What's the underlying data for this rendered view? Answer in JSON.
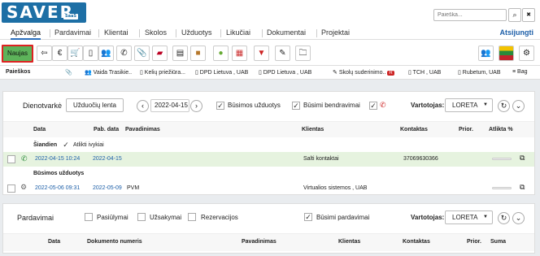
{
  "app": {
    "logo": "SAVER",
    "logo_sub": "SaaS",
    "search_placeholder": "Paieška..."
  },
  "nav": {
    "items": [
      "Apžvalga",
      "Pardavimai",
      "Klientai",
      "Skolos",
      "Užduotys",
      "Likučiai",
      "Dokumentai",
      "Projektai"
    ],
    "logout": "Atsijungti"
  },
  "toolbar": {
    "new_label": "Naujas"
  },
  "recent": {
    "label": "Paieškos",
    "items": [
      "Vaida Trasikie..",
      "Kelių priežiūra...",
      "DPD Lietuva , UAB",
      "DPD Lietuva , UAB",
      "Skolų suderinimo..",
      "TCH , UAB",
      "Rubetum, UAB",
      "Bag"
    ],
    "badge": "R"
  },
  "diary": {
    "title": "Dienotvarkė",
    "tasks_btn": "Užduočių lenta",
    "date": "2022-04-15",
    "chk_future_tasks": "Būsimos užduotys",
    "chk_future_common": "Būsimi bendravimai",
    "user_label": "Vartotojas:",
    "user_value": "LORETA",
    "columns": {
      "date": "Data",
      "pab": "Pab. data",
      "name": "Pavadinimas",
      "client": "Klientas",
      "contact": "Kontaktas",
      "prior": "Prior.",
      "done": "Atlikta %"
    },
    "today_label": "Šiandien",
    "done_events": "Atlikti ivykiai",
    "today_row": {
      "date": "2022-04-15 10:24",
      "pab": "2022-04-15",
      "name": "",
      "client": "Salti kontaktai",
      "contact": "37069630366"
    },
    "future_label": "Būsimos užduotys",
    "future_row": {
      "date": "2022-05-06 09:31",
      "pab": "2022-05-09",
      "name": "PVM",
      "client": "Virtualios sistemos , UAB",
      "contact": ""
    }
  },
  "sales": {
    "title": "Pardavimai",
    "chk_offers": "Pasiūlymai",
    "chk_orders": "Užsakymai",
    "chk_reservations": "Rezervacijos",
    "chk_future": "Būsimi pardavimai",
    "user_label": "Vartotojas:",
    "user_value": "LORETA",
    "columns": {
      "date": "Data",
      "docnum": "Dokumento numeris",
      "name": "Pavadinimas",
      "client": "Klientas",
      "contact": "Kontaktas",
      "prior": "Prior.",
      "sum": "Suma"
    }
  }
}
